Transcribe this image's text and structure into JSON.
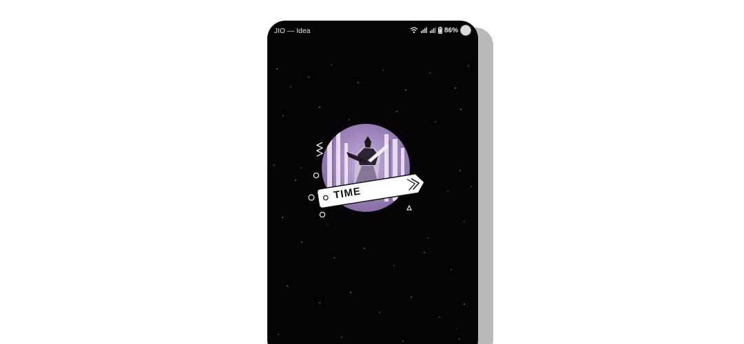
{
  "status_bar": {
    "carrier": "JIO — Idea",
    "battery": "86%",
    "icons": [
      "wifi-icon",
      "signal-icon",
      "signal-icon",
      "battery-icon",
      "avatar"
    ]
  },
  "splash": {
    "banner_text": "TIME",
    "logo": "sword-warrior-logo"
  },
  "colors": {
    "background": "#050306",
    "moon": "#b79fd4",
    "banner": "#ffffff",
    "text": "#111111"
  }
}
